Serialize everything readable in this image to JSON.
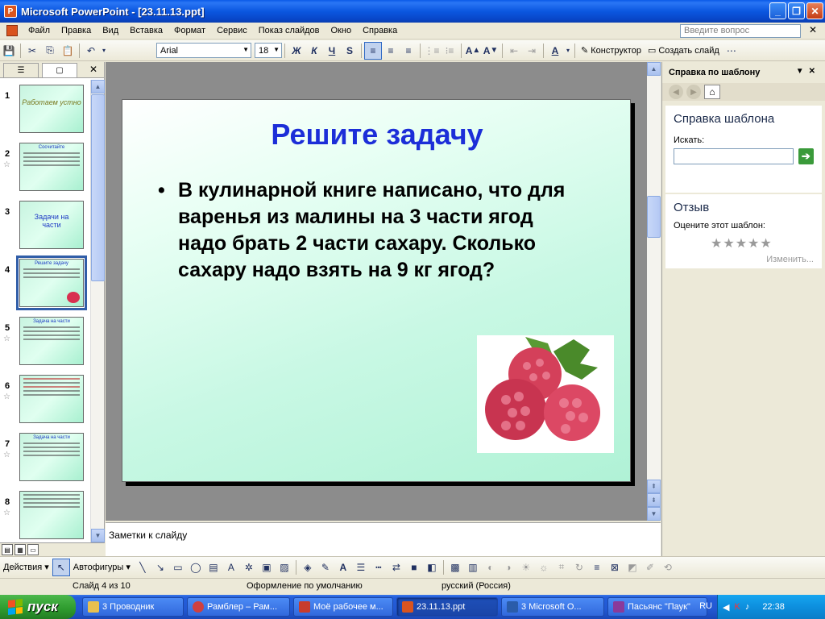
{
  "window": {
    "title": "Microsoft PowerPoint - [23.11.13.ppt]"
  },
  "menu": {
    "items": [
      "Файл",
      "Правка",
      "Вид",
      "Вставка",
      "Формат",
      "Сервис",
      "Показ слайдов",
      "Окно",
      "Справка"
    ],
    "question_placeholder": "Введите вопрос"
  },
  "toolbar": {
    "font": "Arial",
    "size": "18",
    "bold": "Ж",
    "italic": "К",
    "underline": "Ч",
    "shadow": "S",
    "designer": "Конструктор",
    "new_slide": "Создать слайд"
  },
  "slides_pane": {
    "thumbs": [
      {
        "num": "1",
        "text": "Работаем устно"
      },
      {
        "num": "2",
        "text": "Сосчитайте"
      },
      {
        "num": "3",
        "text": "Задачи на части"
      },
      {
        "num": "4",
        "text": "Решите задачу"
      },
      {
        "num": "5",
        "text": "Задача на части"
      },
      {
        "num": "6",
        "text": ""
      },
      {
        "num": "7",
        "text": "Задача на части"
      },
      {
        "num": "8",
        "text": ""
      }
    ]
  },
  "slide": {
    "title": "Решите задачу",
    "bullet": "•",
    "body": "В кулинарной книге написано, что для варенья из малины на 3 части ягод надо брать 2 части сахару. Сколько сахару надо взять на 9 кг ягод?"
  },
  "notes": {
    "placeholder": "Заметки к слайду"
  },
  "taskpane": {
    "title": "Справка по шаблону",
    "section1_title": "Справка шаблона",
    "search_label": "Искать:",
    "section2_title": "Отзыв",
    "rate_label": "Оцените этот шаблон:",
    "stars": "★★★★★",
    "change_link": "Изменить..."
  },
  "drawbar": {
    "actions": "Действия",
    "autoshapes": "Автофигуры"
  },
  "status": {
    "slide": "Слайд 4 из 10",
    "design": "Оформление по умолчанию",
    "language": "русский (Россия)"
  },
  "taskbar": {
    "start": "пуск",
    "tasks": [
      {
        "label": "3 Проводник",
        "color": "#e8c050"
      },
      {
        "label": "Рамблер – Рам...",
        "color": "#d04040"
      },
      {
        "label": "Моё рабочее м...",
        "color": "#c83c2c"
      },
      {
        "label": "23.11.13.ppt",
        "color": "#d9541f"
      },
      {
        "label": "3 Microsoft O...",
        "color": "#2a5caa"
      },
      {
        "label": "Пасьянс \"Паук\"",
        "color": "#8a3a9a"
      }
    ],
    "lang": "RU",
    "clock": "22:38"
  },
  "colors": {
    "title_blue": "#1c2ed8",
    "xp_blue": "#0b57e0",
    "start_green": "#2d9a2d"
  }
}
